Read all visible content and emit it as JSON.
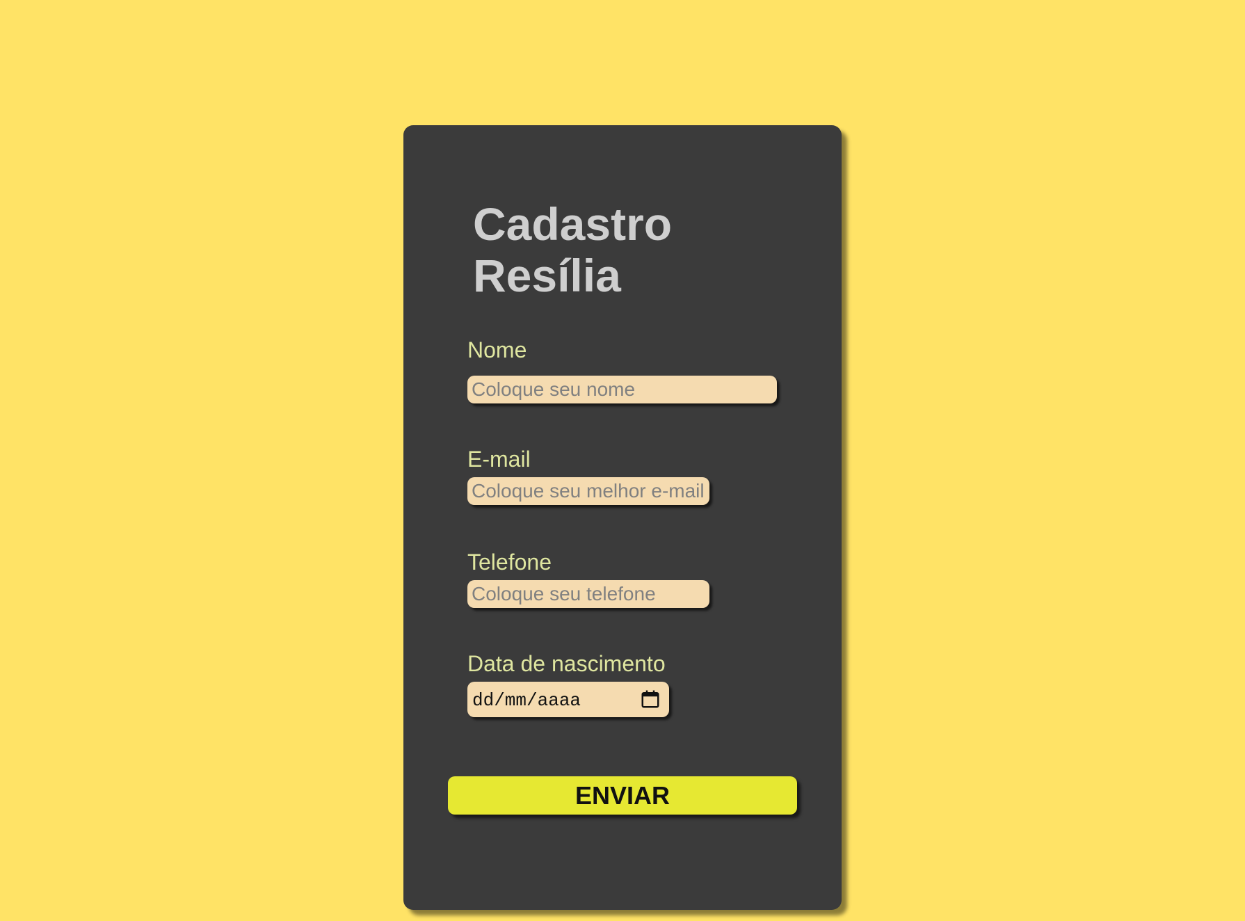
{
  "form": {
    "title_line1": "Cadastro",
    "title_line2": "Resília",
    "fields": {
      "nome": {
        "label": "Nome",
        "placeholder": "Coloque seu nome",
        "value": ""
      },
      "email": {
        "label": "E-mail",
        "placeholder": "Coloque seu melhor e-mail",
        "value": ""
      },
      "telefone": {
        "label": "Telefone",
        "placeholder": "Coloque seu telefone",
        "value": ""
      },
      "nascimento": {
        "label": "Data de nascimento",
        "display": "dd/mm/aaaa",
        "icon": "calendar-icon"
      }
    },
    "submit_label": "ENVIAR"
  },
  "colors": {
    "background": "#ffe366",
    "card": "#3b3b3b",
    "title": "#cfcfcf",
    "label": "#dfe6a0",
    "input_bg": "#f5dbb0",
    "button": "#e6e832"
  }
}
